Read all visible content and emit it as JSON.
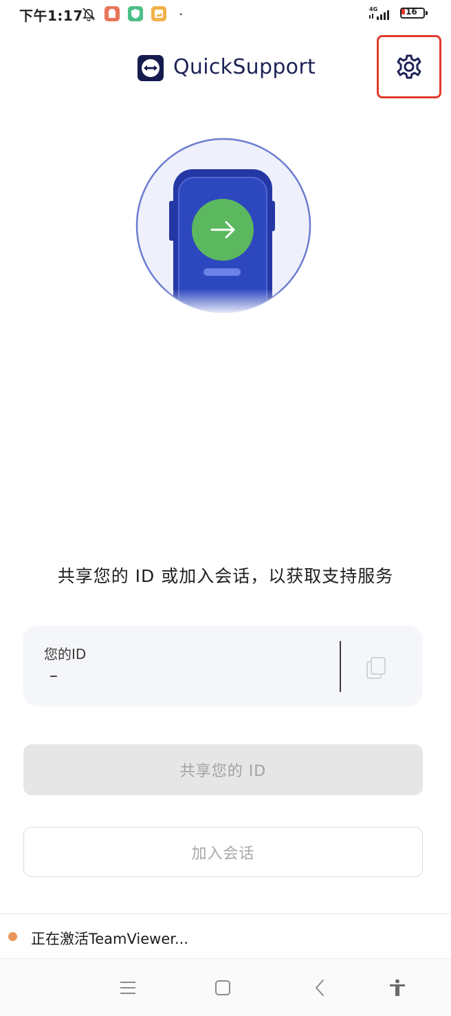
{
  "status_bar": {
    "time": "下午1:17",
    "network": "4G",
    "battery_level": "16",
    "dot": "·"
  },
  "header": {
    "app_title": "QuickSupport",
    "settings_icon": "gear-icon"
  },
  "main": {
    "prompt": "共享您的 ID 或加入会话，以获取支持服务",
    "id_card": {
      "label": "您的ID",
      "value": "–",
      "copy_icon": "copy-icon"
    },
    "share_button_label": "共享您的 ID",
    "join_button_label": "加入会话"
  },
  "activation_status": {
    "text": "正在激活TeamViewer...",
    "dot_color": "#e9965a"
  },
  "colors": {
    "brand_dark": "#151b4d",
    "illustration_phone": "#2b44b8",
    "illustration_button": "#5cb85f",
    "highlight_box": "#e03a2c"
  },
  "nav_bar": {
    "icons": [
      "menu-icon",
      "home-icon",
      "back-icon",
      "accessibility-icon"
    ]
  }
}
